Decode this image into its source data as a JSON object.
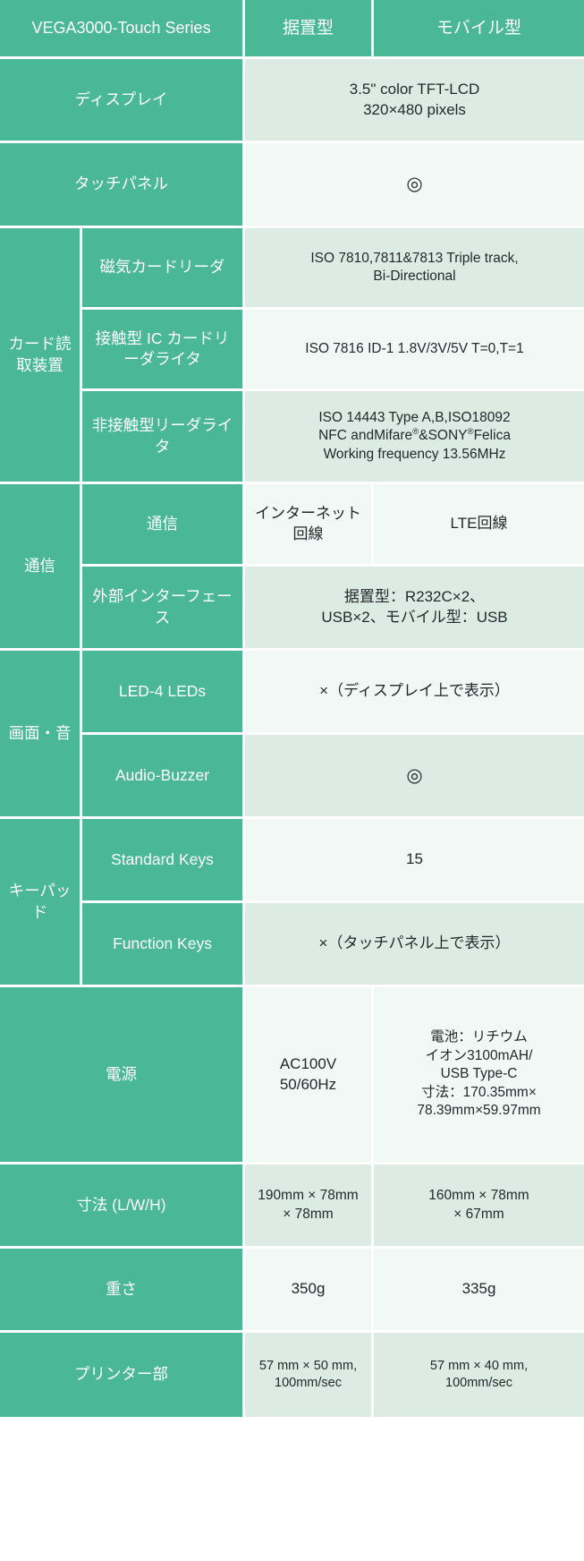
{
  "header": {
    "product": "VEGA3000-Touch Series",
    "col_stationary": "据置型",
    "col_mobile": "モバイル型"
  },
  "marks": {
    "circle": "◎",
    "cross": "×"
  },
  "colors": {
    "label_green": "#4ab795",
    "row_alt_dark": "#dcece5",
    "row_alt_light": "#f1f8f5",
    "text_dark": "#23292b",
    "text_light": "#ffffff",
    "grid_line": "#ffffff"
  },
  "rows": {
    "display": {
      "label": "ディスプレイ",
      "value_line1": "3.5\" color TFT-LCD",
      "value_line2": "320×480 pixels"
    },
    "touch_panel": {
      "label": "タッチパネル",
      "value": "◎"
    },
    "card_reader": {
      "group_label": "カード読取装置",
      "magnetic": {
        "label": "磁気カードリーダ",
        "value_line1": "ISO 7810,7811&7813 Triple track,",
        "value_line2": "Bi-Directional"
      },
      "contact_ic": {
        "label": "接触型 IC カードリーダライタ",
        "value": "ISO 7816 ID-1 1.8V/3V/5V T=0,T=1"
      },
      "contactless": {
        "label": "非接触型リーダライタ",
        "value_line1": "ISO 14443 Type A,B,ISO18092",
        "value_line2_a": "NFC andMifare",
        "value_line2_b": "&SONY",
        "value_line2_c": "Felica",
        "value_line3": "Working frequency 13.56MHz",
        "reg_mark": "®"
      }
    },
    "communication": {
      "group_label": "通信",
      "network": {
        "label": "通信",
        "stationary": "インターネット回線",
        "mobile": "LTE回線"
      },
      "external_interface": {
        "label": "外部インターフェース",
        "value_line1": "据置型：R232C×2、",
        "value_line2": "USB×2、モバイル型：USB"
      }
    },
    "screen_sound": {
      "group_label": "画面・音",
      "led": {
        "label": "LED-4 LEDs",
        "value": "×（ディスプレイ上で表示）"
      },
      "audio": {
        "label": "Audio-Buzzer",
        "value": "◎"
      }
    },
    "keypad": {
      "group_label": "キーパッド",
      "standard_keys": {
        "label": "Standard Keys",
        "value": "15"
      },
      "function_keys": {
        "label": "Function Keys",
        "value": "×（タッチパネル上で表示）"
      }
    },
    "power": {
      "label": "電源",
      "stationary_line1": "AC100V",
      "stationary_line2": "50/60Hz",
      "mobile_line1": "電池：リチウム",
      "mobile_line2": "イオン3100mAH/",
      "mobile_line3": "USB Type-C",
      "mobile_line4": "寸法：170.35mm×",
      "mobile_line5": "78.39mm×59.97mm"
    },
    "dimensions": {
      "label": "寸法 (L/W/H)",
      "stationary_line1": "190mm × 78mm",
      "stationary_line2": "× 78mm",
      "mobile_line1": "160mm × 78mm",
      "mobile_line2": "× 67mm"
    },
    "weight": {
      "label": "重さ",
      "stationary": "350g",
      "mobile": "335g"
    },
    "printer": {
      "label": "プリンター部",
      "stationary_line1": "57 mm × 50 mm,",
      "stationary_line2": "100mm/sec",
      "mobile_line1": "57 mm × 40 mm,",
      "mobile_line2": "100mm/sec"
    }
  }
}
